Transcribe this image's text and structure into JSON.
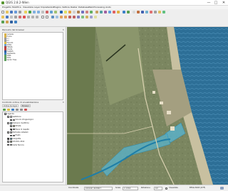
{
  "window": {
    "title": "QGIS 2.8.2-Wien",
    "minimize": "—",
    "maximize": "□",
    "close": "✕"
  },
  "menubar": [
    "Progetto",
    "Modifica",
    "Visualizza",
    "Layer",
    "Impostazioni",
    "Plugins",
    "Vettore",
    "Raster",
    "Database",
    "Web",
    "Processing",
    "Aiuto"
  ],
  "browser_panel": {
    "title": "Pannello del browser",
    "items": [
      "Cartella",
      "Home",
      "C:/",
      "D:/",
      "Favoriti",
      "GPKG",
      "MSSQL",
      "Oracle",
      "PostGIS",
      "SpatiaLite",
      "WMS",
      "WCS",
      "Vector Tiles"
    ]
  },
  "layers_panel": {
    "title": "Controllo ordine di visualizzazione",
    "tabs": [
      "Ordine dei layer",
      "Browser"
    ],
    "group_label": "Legenda",
    "items": [
      {
        "label": "Vestizione",
        "swatch": "#ffffff",
        "checked": true,
        "indent": 0
      },
      {
        "label": "Vincolo idrogeologico",
        "swatch": "#f2a0a0",
        "checked": true,
        "indent": 1
      },
      {
        "label": "Demanio marittimo",
        "swatch": "#9fd3e8",
        "checked": false,
        "indent": 0
      },
      {
        "label": "Strade",
        "swatch": "#e8e0a0",
        "checked": true,
        "indent": 1
      },
      {
        "label": "Fasce di rispetto",
        "swatch": "#4fb4d0",
        "checked": true,
        "indent": 1
      },
      {
        "label": "Particelle catastali",
        "swatch": "#d0d0d0",
        "checked": true,
        "indent": 0
      },
      {
        "label": "Foglio",
        "swatch": "#ffffff",
        "checked": false,
        "indent": 1
      },
      {
        "label": "Idrografia",
        "swatch": "#2aa3c8",
        "checked": true,
        "indent": 0
      },
      {
        "label": "Ortofoto 2012",
        "swatch": "#7a8c60",
        "checked": true,
        "indent": 0
      },
      {
        "label": "Carta Tecnica",
        "swatch": "#cccccc",
        "checked": false,
        "indent": 0
      }
    ]
  },
  "statusbar": {
    "coord_label": "Coordinata",
    "coord_value": "1001427,4434917",
    "scale_label": "Scala",
    "scale_value": "1:4.516",
    "rotation_label": "Rotazione",
    "rotation_value": "0,0",
    "render_label": "Visualizza",
    "crs": "EPSG:3003 (OTF)"
  }
}
